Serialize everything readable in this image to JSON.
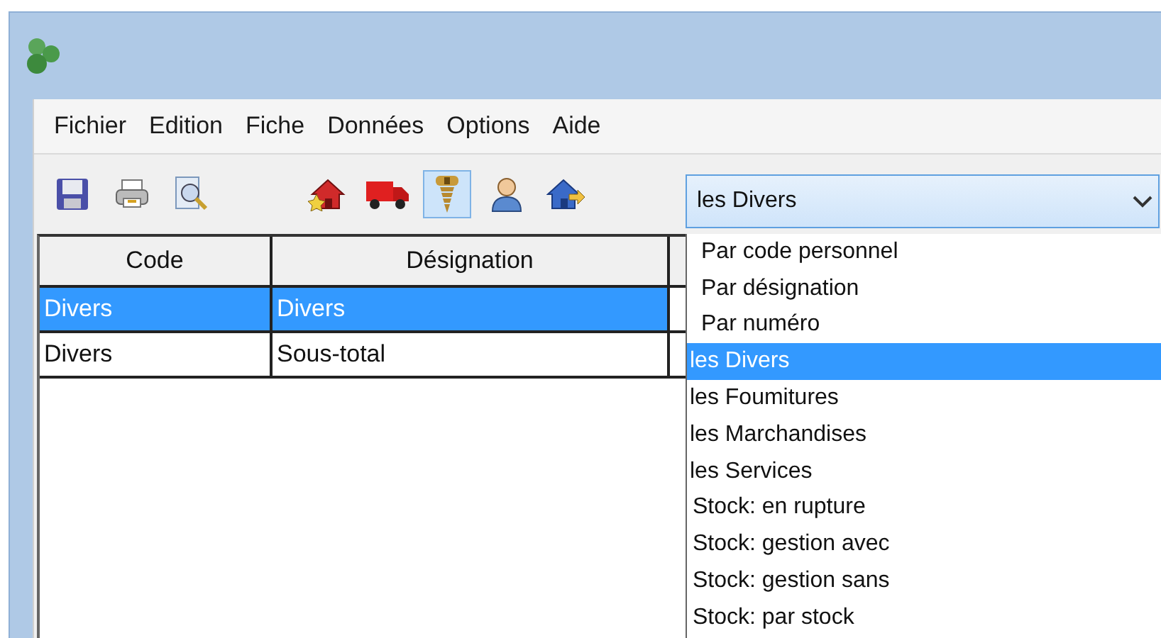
{
  "menu": [
    "Fichier",
    "Edition",
    "Fiche",
    "Données",
    "Options",
    "Aide"
  ],
  "toolbar": [
    {
      "kind": "save",
      "selected": false
    },
    {
      "kind": "print",
      "selected": false
    },
    {
      "kind": "preview",
      "selected": false
    },
    {
      "kind": "house-star",
      "selected": false
    },
    {
      "kind": "truck",
      "selected": false
    },
    {
      "kind": "screw",
      "selected": true
    },
    {
      "kind": "person",
      "selected": false
    },
    {
      "kind": "house-arrow",
      "selected": false
    }
  ],
  "filter_combo": {
    "value": "les Divers",
    "options": [
      {
        "label": "Par code personnel",
        "kind": "sort",
        "selected": false
      },
      {
        "label": "Par désignation",
        "kind": "sort",
        "selected": false
      },
      {
        "label": "Par numéro",
        "kind": "sort",
        "selected": false
      },
      {
        "label": "les Divers",
        "kind": "filter",
        "selected": true
      },
      {
        "label": "les Foumitures",
        "kind": "filter",
        "selected": false
      },
      {
        "label": "les Marchandises",
        "kind": "filter",
        "selected": false
      },
      {
        "label": "les Services",
        "kind": "filter",
        "selected": false
      },
      {
        "label": "Stock: en rupture",
        "kind": "stock",
        "selected": false
      },
      {
        "label": "Stock: gestion avec",
        "kind": "stock",
        "selected": false
      },
      {
        "label": "Stock: gestion sans",
        "kind": "stock",
        "selected": false
      },
      {
        "label": "Stock: par stock",
        "kind": "stock",
        "selected": false
      }
    ]
  },
  "table": {
    "columns": [
      "Code",
      "Désignation"
    ],
    "rows": [
      {
        "cells": [
          "Divers",
          "Divers"
        ],
        "selected": true
      },
      {
        "cells": [
          "Divers",
          "Sous-total"
        ],
        "selected": false
      }
    ]
  }
}
